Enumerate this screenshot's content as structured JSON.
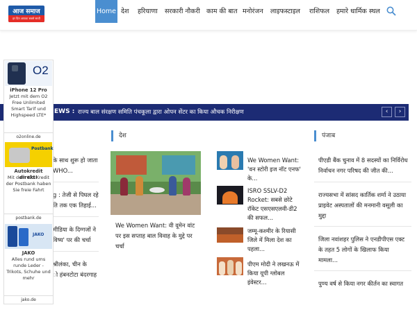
{
  "header": {
    "logo_text": "आज समाज",
    "logo_sub": "हर दिन आपका सबसे साथी",
    "nav": [
      "Home",
      "देश",
      "हरियाणा",
      "सरकारी नौकरी",
      "काम की बात",
      "मनोरंजन",
      "लाइफस्टाइल",
      "राशिफल",
      "हमारे धार्मिक स्थल"
    ],
    "search_icon": "search-icon"
  },
  "ad": {
    "block1": {
      "title": "iPhone 12 Pro",
      "text": "Jetzt mit dem O2 Free Unlimited Smart Tarif und Highspeed LTE*",
      "domain": "o2online.de",
      "brand": "O2"
    },
    "block2": {
      "title": "Autokredit direkt!",
      "text": "Mit dem Kfz-Kredit der Postbank haben Sie freie Fahrt",
      "domain": "postbank.de",
      "brand": "Postbank"
    },
    "block3": {
      "title": "JAKO",
      "text": "Alles rund ums runde Leder - Trikots, Schuhe und mehr",
      "domain": "jako.de",
      "brand": "JAKO"
    }
  },
  "ticker": {
    "label": "EWS :",
    "text": "राज्य बाल संरक्षण समिति पंचकूला द्वारा ओपन सेंटर का किया औचक निरीक्षण",
    "prev": "‹",
    "next": "›"
  },
  "left_col": {
    "items": [
      {
        "line1": "के साथ शुरू हो जाता",
        "line2": "WHO..."
      },
      {
        "line1": "g : तेजी से पिघल रहे",
        "line2": "ति तक एक तिहाई..."
      },
      {
        "line1": "मीडिया के दिग्गजों ने",
        "line2": "विष्य' पर की चर्चा"
      },
      {
        "line1": "श्रीलंका, चीन के",
        "line2": "ो हंबनटोटा बंदरगाह"
      }
    ]
  },
  "desh": {
    "heading": "देश",
    "main_title": "We Women Want: वी वूमेन वांट पर इस सप्ताह बाल विवाह के मुद्दे पर चर्चा",
    "main_lines": [
      "We Women Want: वी वूमेन वांट",
      "पर इस सप्ताह बाल विवाह के मुद्दे पर",
      "चर्चा"
    ],
    "list": [
      {
        "lines": [
          "We Women Want:",
          "'वन स्टोरी इज नॉट एनफ'",
          "के..."
        ]
      },
      {
        "lines": [
          "ISRO SSLV-D2",
          "Rocket: सबसे छोटे",
          "रॉकेट एसएसएलवी-डी2",
          "की सफल..."
        ]
      },
      {
        "lines": [
          "जम्मू-कश्मीर के रियासी",
          "जिले में मिला देश का",
          "पहला..."
        ]
      },
      {
        "lines": [
          "पीएम मोदी ने लखनऊ में",
          "किया यूपी ग्लोबल",
          "इंवेस्टर..."
        ]
      }
    ]
  },
  "punjab": {
    "heading": "पंजाब",
    "items": [
      {
        "lines": [
          "पीएडी बैंक चुनाव में 8 सदस्यों का निर्विरोध",
          "निर्वाचन नगर परिषद की जीत की..."
        ]
      },
      {
        "lines": [
          "राज्यसभा में सांसद कार्तिक शर्मा ने उठाया",
          "प्राइवेट अस्पतालों की मनमानी वसूली का",
          "मुद्दा"
        ]
      },
      {
        "lines": [
          "जिला नवांशहर पुलिस ने एनडीपीएस एक्ट",
          "के तहत 5 लोगों के खिलाफ किया",
          "मामला..."
        ]
      },
      {
        "lines": [
          "पुण्य वर्ष से किया नगर कीर्तन का स्वागत"
        ]
      }
    ]
  }
}
